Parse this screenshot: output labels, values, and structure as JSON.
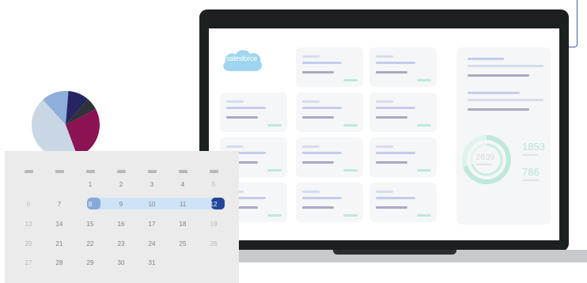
{
  "logo": {
    "text": "salesforce",
    "color": "#9fd5ef"
  },
  "stats": {
    "total": "2639",
    "first": "1853",
    "second": "786"
  },
  "calendar": {
    "weeks": [
      [
        "",
        "",
        "1",
        "2",
        "3",
        "4",
        "5"
      ],
      [
        "6",
        "7",
        "8",
        "9",
        "10",
        "11",
        "12"
      ],
      [
        "13",
        "14",
        "15",
        "16",
        "17",
        "18",
        "19"
      ],
      [
        "20",
        "21",
        "22",
        "23",
        "24",
        "25",
        "26"
      ],
      [
        "27",
        "28",
        "29",
        "30",
        "31",
        "",
        ""
      ]
    ],
    "selected_start": "8",
    "selected_end": "12"
  },
  "pie_chart": {
    "slices": [
      {
        "name": "light-blue",
        "color": "#8faedb",
        "value": 13
      },
      {
        "name": "navy",
        "color": "#242561",
        "value": 10
      },
      {
        "name": "dark-grey",
        "color": "#2f3239",
        "value": 6
      },
      {
        "name": "maroon",
        "color": "#8b1353",
        "value": 27
      },
      {
        "name": "pale-grey",
        "color": "#c9d6e4",
        "value": 44
      }
    ]
  },
  "colors": {
    "accent_green": "#bfe8da",
    "accent_blue": "#24479a",
    "frame": "#1d2021"
  }
}
